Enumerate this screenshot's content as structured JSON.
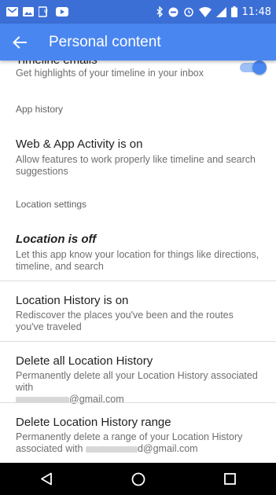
{
  "status_bar": {
    "time": "11:48",
    "left_icons": [
      "gmail-icon",
      "image-icon",
      "debug-icon",
      "youtube-icon"
    ],
    "right_icons": [
      "bluetooth-icon",
      "do-not-disturb-icon",
      "alarm-icon",
      "wifi-icon",
      "signal-icon",
      "battery-icon"
    ]
  },
  "app_bar": {
    "title": "Personal content",
    "back_icon": "arrow-back-icon",
    "color": "#4a86f0"
  },
  "content": {
    "timeline_emails": {
      "title": "Timeline emails",
      "subtitle": "Get highlights of your timeline in your inbox",
      "toggle_on": true
    },
    "app_history": {
      "header": "App history",
      "web_app_activity": {
        "title": "Web & App Activity is on",
        "subtitle": "Allow features to work properly like timeline and search suggestions"
      }
    },
    "location_settings": {
      "header": "Location settings",
      "location": {
        "title": "Location is off",
        "subtitle": "Let this app know your location for things like directions, timeline, and search"
      },
      "location_history": {
        "title": "Location History is on",
        "subtitle": "Rediscover the places you've been and the routes you've traveled"
      },
      "delete_all": {
        "title": "Delete all Location History",
        "subtitle_line1": "Permanently delete all your Location History associated with",
        "email_suffix": "@gmail.com"
      },
      "delete_range": {
        "title": "Delete Location History range",
        "subtitle_line1": "Permanently delete a range of your Location History",
        "subtitle_prefix": "associated with",
        "email_suffix": "d@gmail.com"
      }
    }
  },
  "nav_bar": {
    "icons": [
      "nav-back-icon",
      "home-icon",
      "recents-icon"
    ]
  }
}
